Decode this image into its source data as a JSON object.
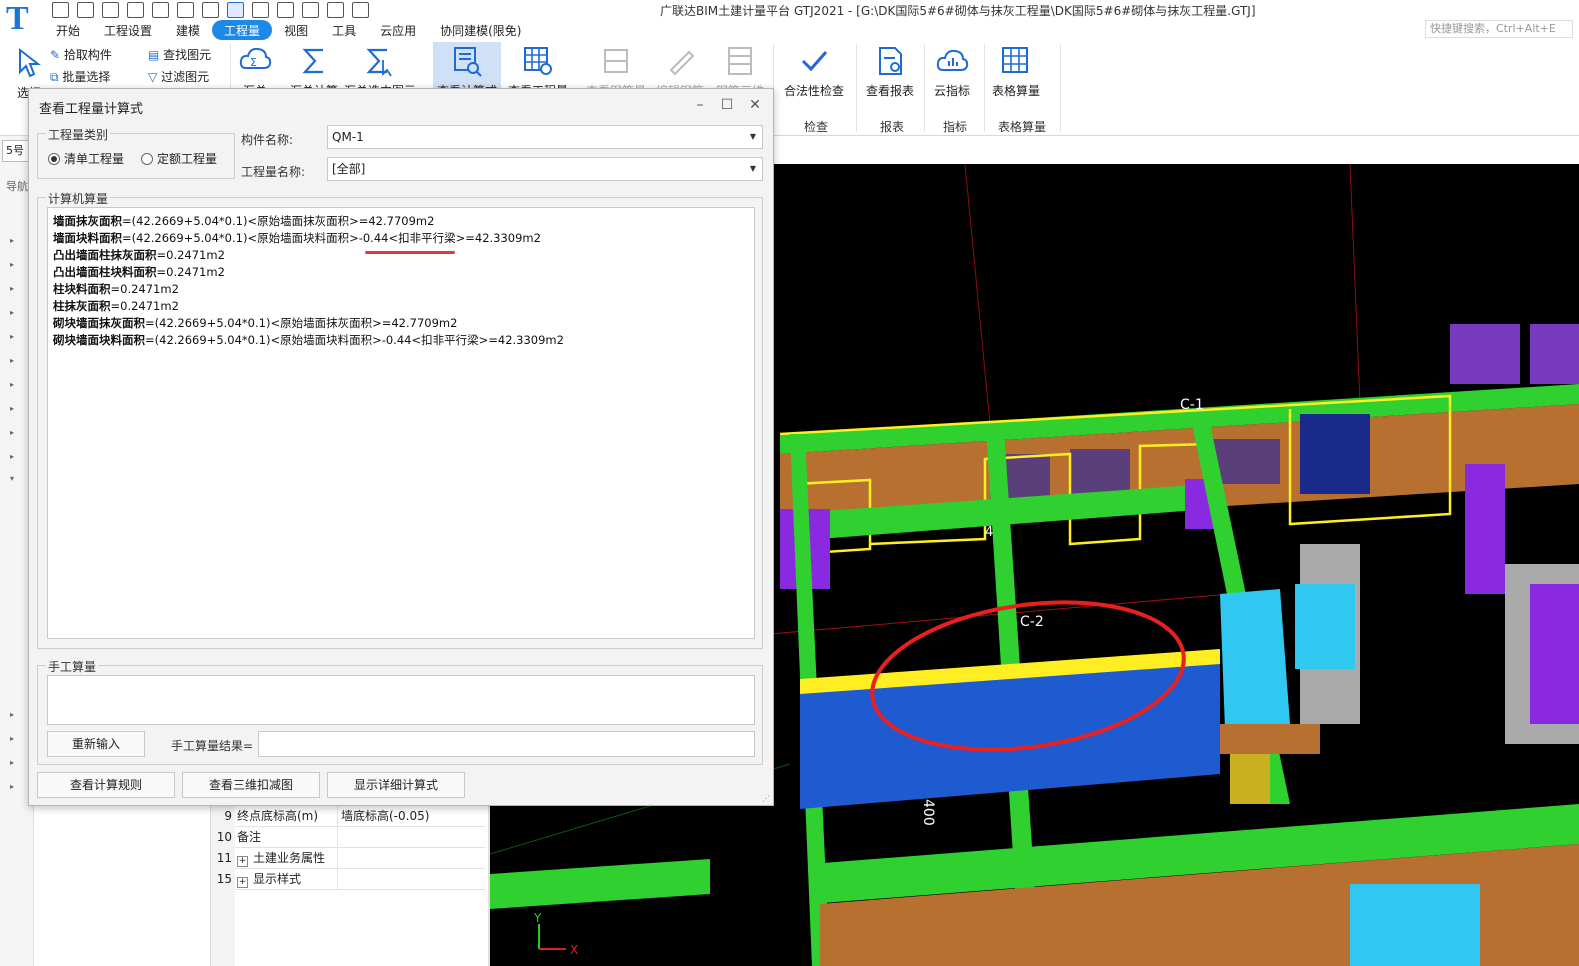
{
  "app": {
    "title": "广联达BIM土建计量平台 GTJ2021 - [G:\\DK国际5#6#砌体与抹灰工程量\\DK国际5#6#砌体与抹灰工程量.GTJ]",
    "logo": "T",
    "quick_search_placeholder": "快捷键搜索，Ctrl+Alt+E"
  },
  "menu": [
    "开始",
    "工程设置",
    "建模",
    "工程量",
    "视图",
    "工具",
    "云应用",
    "协同建模(限免)"
  ],
  "menu_active_index": 3,
  "ribbon": {
    "select": "选择",
    "pick_component": "拾取构件",
    "batch_select": "批量选择",
    "find_element": "查找图元",
    "filter_element": "过滤图元",
    "summary_calc": "汇总",
    "summary_selected": "汇总计算",
    "summary_selected_elements": "汇总选中图元",
    "view_calc": "查看计算式",
    "view_quantity": "查看工程量",
    "disabled_1": "查看钢筋量",
    "disabled_2": "编辑钢筋",
    "disabled_3": "钢筋三维",
    "legality_check": "合法性检查",
    "view_report": "查看报表",
    "cloud_indicator": "云指标",
    "table_calc": "表格算量",
    "group_check": "检查",
    "group_report": "报表",
    "group_indicator": "指标",
    "group_table": "表格算量"
  },
  "left_panel": {
    "floor_field": "5号",
    "nav_label": "导航"
  },
  "properties": [
    {
      "num": "9",
      "name": "终点底标高(m)",
      "value": "墙底标高(-0.05)",
      "expandable": false
    },
    {
      "num": "10",
      "name": "备注",
      "value": "",
      "expandable": false
    },
    {
      "num": "11",
      "name": "土建业务属性",
      "value": "",
      "expandable": true
    },
    {
      "num": "15",
      "name": "显示样式",
      "value": "",
      "expandable": true
    }
  ],
  "viewport": {
    "axis_labels": [
      "C-1",
      "C-2",
      "400",
      "4"
    ],
    "axis_x": "X",
    "axis_y": "Y"
  },
  "dialog": {
    "title": "查看工程量计算式",
    "category_group": "工程量类别",
    "radio_list": "清单工程量",
    "radio_quota": "定额工程量",
    "component_label": "构件名称:",
    "component_value": "QM-1",
    "quantity_label": "工程量名称:",
    "quantity_value": "[全部]",
    "calc_group": "计算机算量",
    "calc_lines": [
      {
        "name": "墙面抹灰面积",
        "formula": "=(42.2669+5.04*0.1)<原始墙面抹灰面积>=42.7709m2"
      },
      {
        "name": "墙面块料面积",
        "formula": "=(42.2669+5.04*0.1)<原始墙面块料面积>-0.44<扣非平行梁>=42.3309m2"
      },
      {
        "name": "凸出墙面柱抹灰面积",
        "formula": "=0.2471m2"
      },
      {
        "name": "凸出墙面柱块料面积",
        "formula": "=0.2471m2"
      },
      {
        "name": "柱块料面积",
        "formula": "=0.2471m2"
      },
      {
        "name": "柱抹灰面积",
        "formula": "=0.2471m2"
      },
      {
        "name": "砌块墙面抹灰面积",
        "formula": "=(42.2669+5.04*0.1)<原始墙面抹灰面积>=42.7709m2"
      },
      {
        "name": "砌块墙面块料面积",
        "formula": "=(42.2669+5.04*0.1)<原始墙面块料面积>-0.44<扣非平行梁>=42.3309m2"
      }
    ],
    "manual_group": "手工算量",
    "reenter_button": "重新输入",
    "manual_result_label": "手工算量结果=",
    "view_rules_button": "查看计算规则",
    "view_3d_button": "查看三维扣减图",
    "show_detail_button": "显示详细计算式"
  }
}
